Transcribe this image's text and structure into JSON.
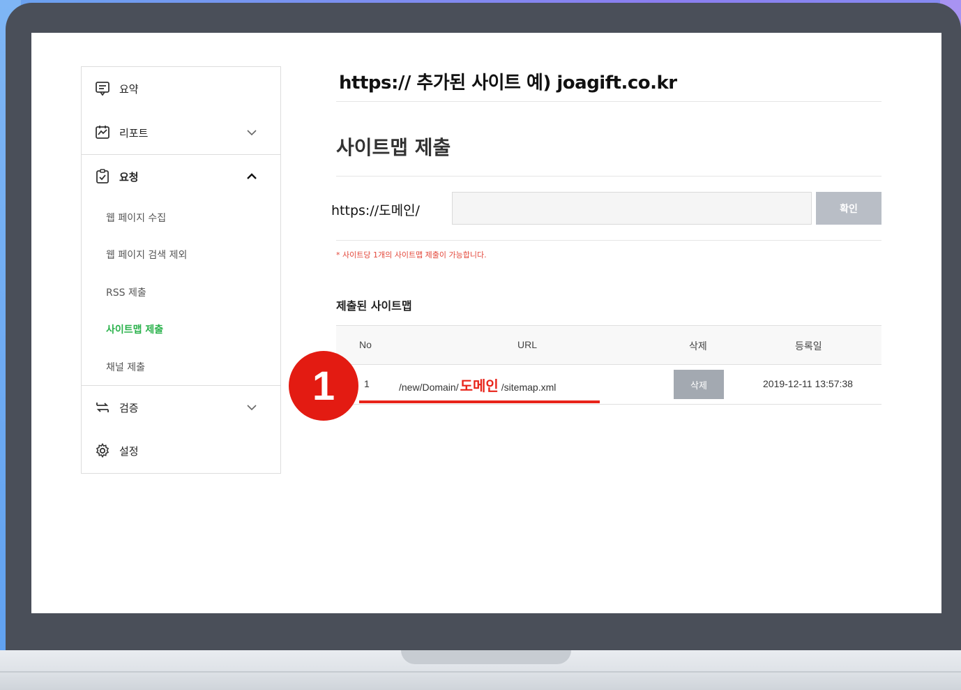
{
  "sidebar": {
    "items": [
      {
        "label": "요약",
        "icon": "summary-icon"
      },
      {
        "label": "리포트",
        "icon": "report-icon"
      },
      {
        "label": "요청",
        "icon": "request-icon"
      },
      {
        "label": "검증",
        "icon": "verify-icon"
      },
      {
        "label": "설정",
        "icon": "settings-gear-icon"
      }
    ],
    "sub_items": [
      {
        "label": "웹 페이지 수집"
      },
      {
        "label": "웹 페이지 검색 제외"
      },
      {
        "label": "RSS 제출"
      },
      {
        "label": "사이트맵 제출",
        "active": true
      },
      {
        "label": "채널 제출"
      }
    ]
  },
  "main": {
    "site_title": "https:// 추가된 사이트 예) joagift.co.kr",
    "page_title": "사이트맵 제출",
    "input_prefix": "https://도메인/",
    "input_value": "",
    "confirm_label": "확인",
    "notice": "* 사이트당 1개의 사이트맵 제출이 가능합니다.",
    "section_title": "제출된 사이트맵",
    "table": {
      "headers": [
        "No",
        "URL",
        "삭제",
        "등록일"
      ],
      "rows": [
        {
          "no": "1",
          "url_prefix": "/new/Domain/",
          "url_highlight": "도메인",
          "url_suffix": "/sitemap.xml",
          "delete_label": "삭제",
          "date": "2019-12-11 13:57:38"
        }
      ]
    },
    "annotation_badge": "1"
  },
  "colors": {
    "active_green": "#2bb24c",
    "notice_red": "#e3473a",
    "highlight_red": "#e8241a",
    "button_gray": "#b9bec6",
    "laptop_frame": "#4a4f59"
  }
}
